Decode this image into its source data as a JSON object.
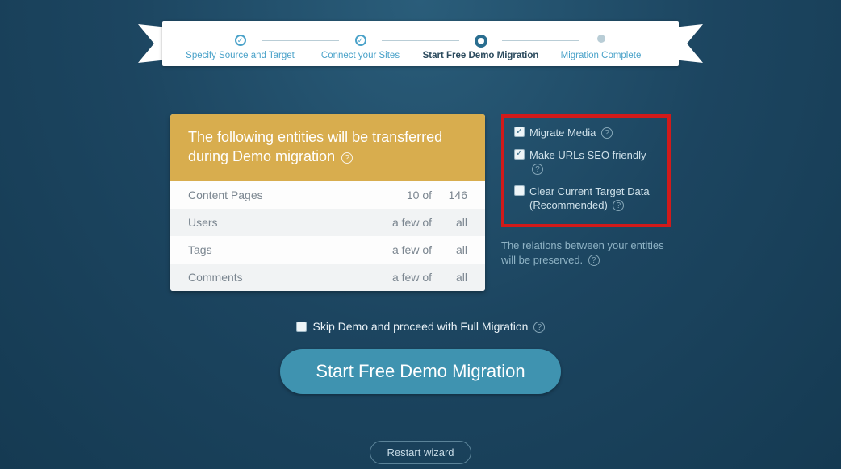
{
  "stepper": {
    "steps": [
      {
        "label": "Specify Source and Target",
        "state": "done"
      },
      {
        "label": "Connect your Sites",
        "state": "done"
      },
      {
        "label": "Start Free Demo Migration",
        "state": "active"
      },
      {
        "label": "Migration Complete",
        "state": "pending"
      }
    ]
  },
  "card": {
    "heading": "The following entities will be transferred during Demo migration",
    "rows": [
      {
        "label": "Content Pages",
        "qty": "10 of",
        "total": "146"
      },
      {
        "label": "Users",
        "qty": "a few of",
        "total": "all"
      },
      {
        "label": "Tags",
        "qty": "a few of",
        "total": "all"
      },
      {
        "label": "Comments",
        "qty": "a few of",
        "total": "all"
      }
    ]
  },
  "options": [
    {
      "label": "Migrate Media",
      "checked": true
    },
    {
      "label": "Make URLs SEO friendly",
      "checked": true
    },
    {
      "label": "Clear Current Target Data (Recommended)",
      "checked": false
    }
  ],
  "relations_note": "The relations between your entities will be preserved.",
  "skip_label": "Skip Demo and proceed with Full Migration",
  "cta_label": "Start Free Demo Migration",
  "restart_label": "Restart wizard",
  "glyphs": {
    "check": "✓",
    "question": "?"
  }
}
